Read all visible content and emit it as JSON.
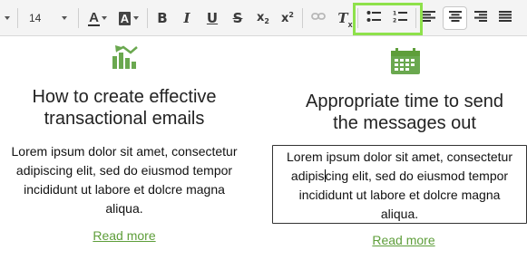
{
  "toolbar": {
    "font_size": "14",
    "icons": [
      "chevron-down-icon",
      "font-color-icon",
      "background-color-icon",
      "bold-icon",
      "italic-icon",
      "underline-icon",
      "strikethrough-icon",
      "subscript-icon",
      "superscript-icon",
      "link-icon",
      "clear-format-icon",
      "bulleted-list-icon",
      "numbered-list-icon",
      "align-left-icon",
      "align-center-icon",
      "align-right-icon",
      "justify-icon"
    ],
    "bold_label": "B",
    "italic_label": "I",
    "underline_label": "U",
    "strike_label": "S",
    "sub_label": "x",
    "sup_label": "x",
    "font_color_label": "A",
    "bg_color_label": "A",
    "clear_label": "T",
    "highlight_color": "#8ee14b"
  },
  "blocks": [
    {
      "icon": "bar-chart-growth-icon",
      "title_line1": "How to create effective",
      "title_line2": "transactional emails",
      "body_lines": [
        "Lorem ipsum dolor sit amet, consectetur",
        "adipiscing elit, sed do eiusmod tempor",
        "incididunt ut labore et dolcre magna",
        "aliqua."
      ],
      "link": "Read more"
    },
    {
      "icon": "calendar-icon",
      "title_line1": "Appropriate time to send",
      "title_line2": "the messages out",
      "body_lines_pre": "Lorem ipsum dolor sit amet, consectetur",
      "body_line2_a": "adipis",
      "body_line2_b": "cing elit, sed do eiusmod tempor",
      "body_line3": "incididunt ut labore et dolcre magna",
      "body_line4": "aliqua.",
      "link": "Read more"
    }
  ],
  "colors": {
    "accent_green": "#5e9e3a",
    "icon_green": "#6aa84f"
  }
}
